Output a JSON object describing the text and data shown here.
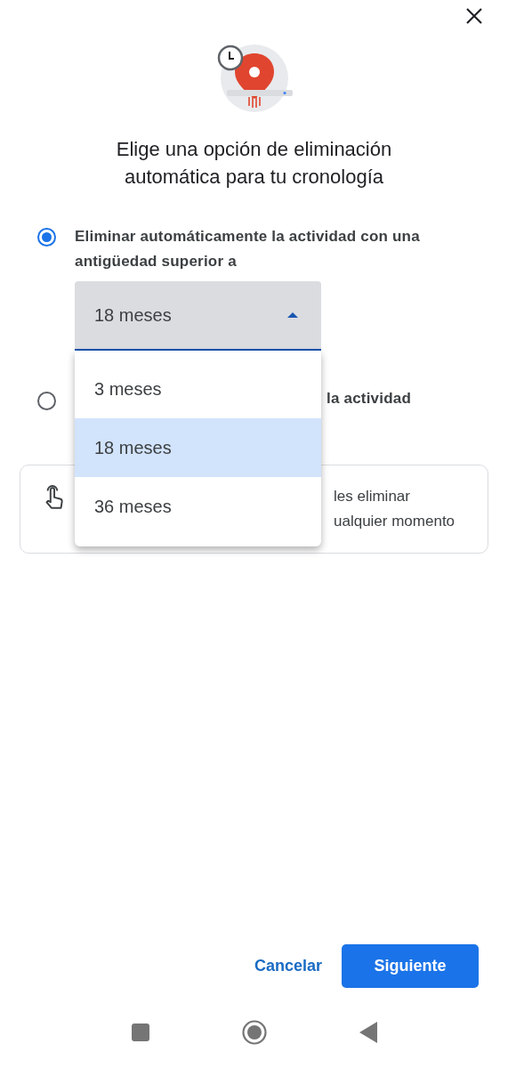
{
  "title": "Elige una opción de eliminación automática para tu cronología",
  "options": [
    {
      "label": "Eliminar automáticamente la actividad con una antigüedad superior a",
      "selected": true
    },
    {
      "label": "la actividad",
      "selected": false
    }
  ],
  "dropdown": {
    "value": "18 meses",
    "expanded": true,
    "items": [
      {
        "label": "3 meses",
        "selected": false
      },
      {
        "label": "18 meses",
        "selected": true
      },
      {
        "label": "36 meses",
        "selected": false
      }
    ]
  },
  "info": {
    "lines": [
      "les eliminar",
      "ualquier momento"
    ]
  },
  "buttons": [
    {
      "label": "Cancelar",
      "kind": "text"
    },
    {
      "label": "Siguiente",
      "kind": "filled"
    }
  ]
}
